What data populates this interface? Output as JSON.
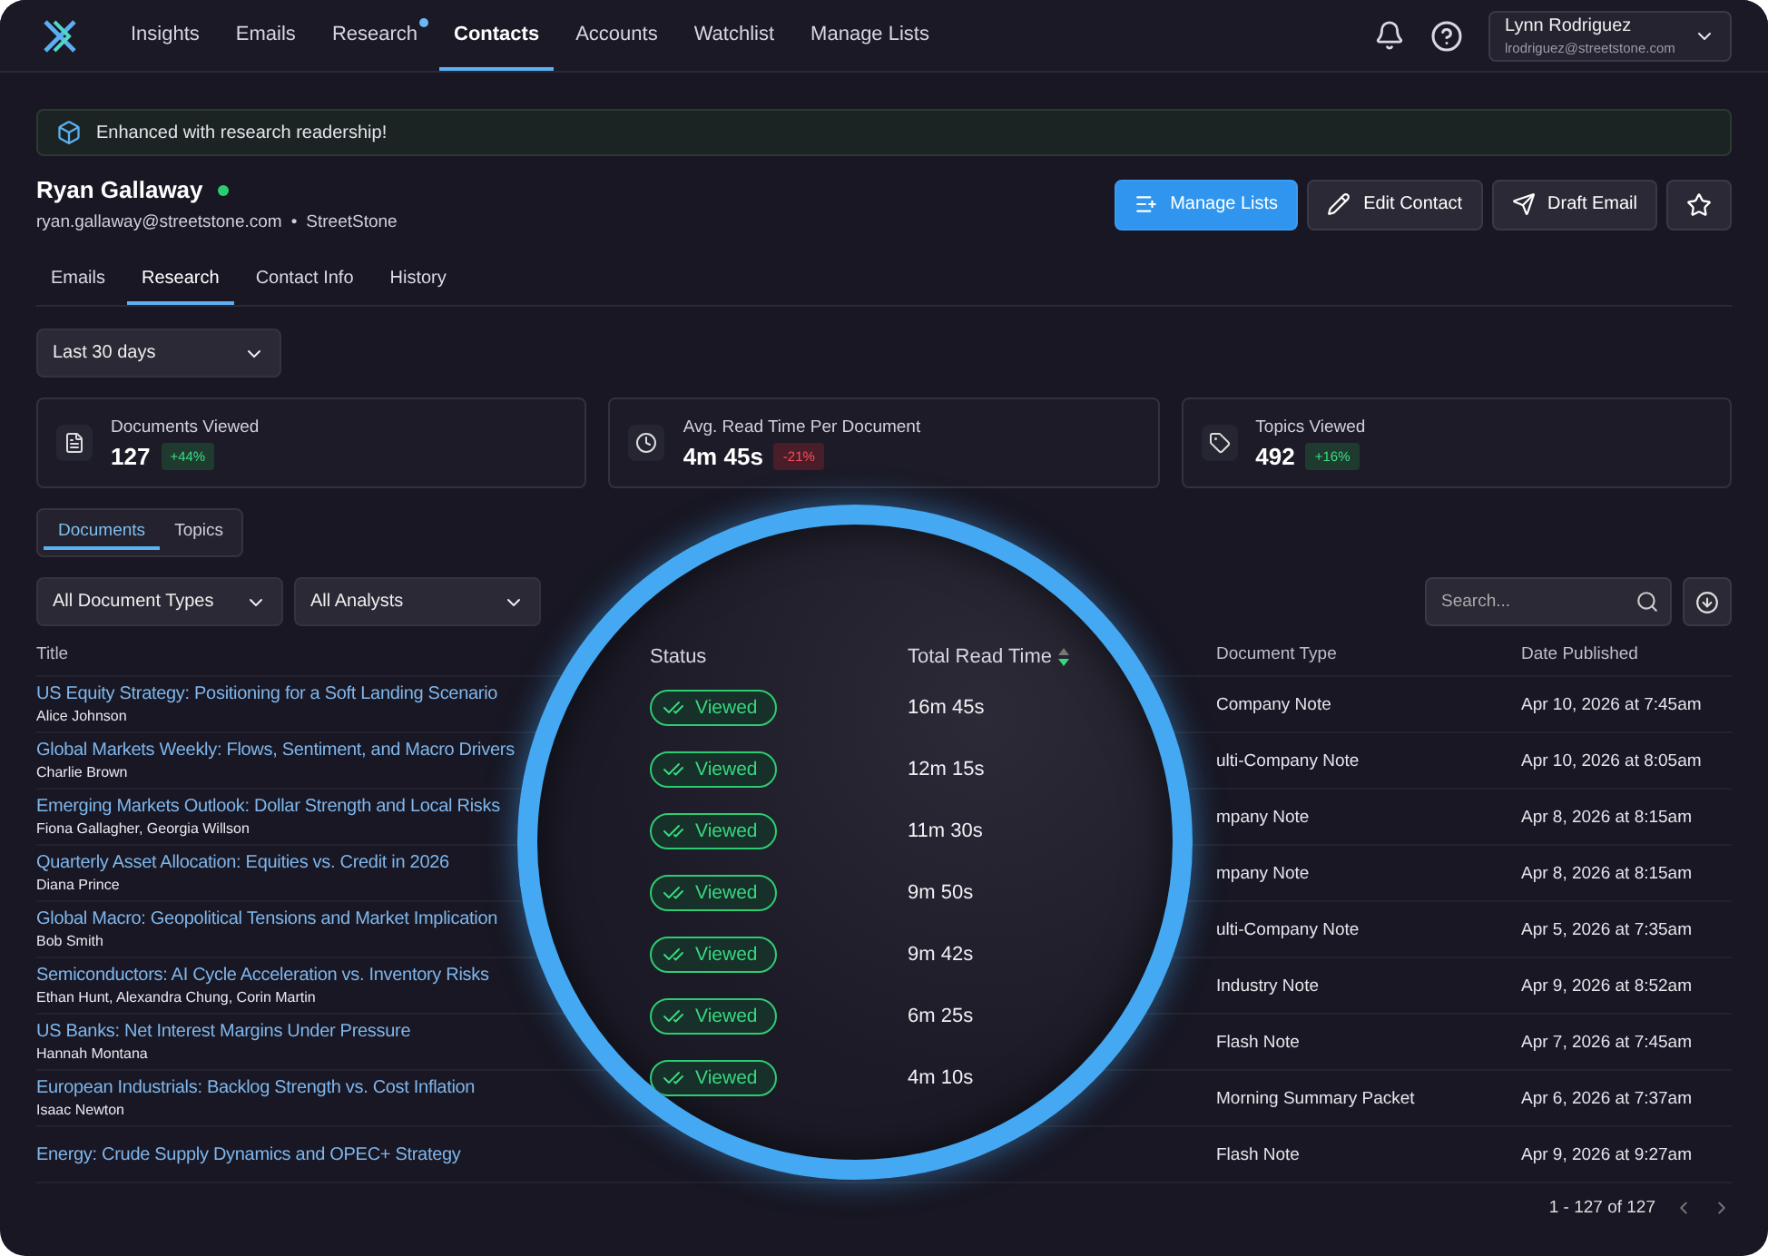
{
  "nav": {
    "items": [
      {
        "label": "Insights",
        "selected": false,
        "dot": false
      },
      {
        "label": "Emails",
        "selected": false,
        "dot": false
      },
      {
        "label": "Research",
        "selected": false,
        "dot": true
      },
      {
        "label": "Contacts",
        "selected": true,
        "dot": false
      },
      {
        "label": "Accounts",
        "selected": false,
        "dot": false
      },
      {
        "label": "Watchlist",
        "selected": false,
        "dot": false
      },
      {
        "label": "Manage Lists",
        "selected": false,
        "dot": false
      }
    ],
    "user": {
      "name": "Lynn Rodriguez",
      "email": "lrodriguez@streetstone.com"
    }
  },
  "banner": {
    "text": "Enhanced with research readership!"
  },
  "contact": {
    "name": "Ryan Gallaway",
    "online": true,
    "email": "ryan.gallaway@streetstone.com",
    "separator": "•",
    "company": "StreetStone"
  },
  "actions": [
    {
      "label": "Manage Lists",
      "kind": "primary"
    },
    {
      "label": "Edit Contact",
      "kind": "edit"
    },
    {
      "label": "Draft Email",
      "kind": "send"
    }
  ],
  "tabs": [
    {
      "label": "Emails",
      "selected": false
    },
    {
      "label": "Research",
      "selected": true
    },
    {
      "label": "Contact Info",
      "selected": false
    },
    {
      "label": "History",
      "selected": false
    }
  ],
  "period": {
    "value": "Last 30 days"
  },
  "stats": [
    {
      "kind": "document",
      "label": "Documents Viewed",
      "value": "127",
      "change": "+44%",
      "rising": true
    },
    {
      "kind": "clock",
      "label": "Avg. Read Time Per Document",
      "value": "4m 45s",
      "change": "-21%",
      "rising": false
    },
    {
      "kind": "tag",
      "label": "Topics Viewed",
      "value": "492",
      "change": "+16%",
      "rising": true
    }
  ],
  "doc_tabs": [
    {
      "label": "Documents",
      "selected": true
    },
    {
      "label": "Topics",
      "selected": false
    }
  ],
  "filters": [
    "All Document Types",
    "All Analysts"
  ],
  "search": {
    "placeholder": "Search..."
  },
  "table": {
    "columns": [
      "Title",
      "Document Type",
      "Date Published"
    ],
    "rows": [
      {
        "title": "US Equity Strategy: Positioning for a Soft Landing Scenario",
        "authors": "Alice Johnson",
        "doc_type": "Company Note",
        "date": "Apr 10, 2026 at 7:45am"
      },
      {
        "title": "Global Markets Weekly: Flows, Sentiment, and Macro Drivers",
        "authors": "Charlie Brown",
        "doc_type": "ulti-Company Note",
        "date": "Apr 10, 2026 at 8:05am"
      },
      {
        "title": "Emerging Markets Outlook: Dollar Strength and Local Risks",
        "authors": "Fiona Gallagher, Georgia Willson",
        "doc_type": "mpany Note",
        "date": "Apr 8, 2026 at 8:15am"
      },
      {
        "title": "Quarterly Asset Allocation: Equities vs. Credit in 2026",
        "authors": "Diana Prince",
        "doc_type": "mpany Note",
        "date": "Apr 8, 2026 at 8:15am"
      },
      {
        "title": "Global Macro: Geopolitical Tensions and Market Implication",
        "authors": "Bob Smith",
        "doc_type": "ulti-Company Note",
        "date": "Apr 5, 2026 at 7:35am"
      },
      {
        "title": "Semiconductors: AI Cycle Acceleration vs. Inventory Risks",
        "authors": "Ethan Hunt, Alexandra Chung, Corin Martin",
        "doc_type": "Industry Note",
        "date": "Apr 9, 2026 at 8:52am"
      },
      {
        "title": "US Banks: Net Interest Margins Under Pressure",
        "authors": "Hannah Montana",
        "doc_type": "Flash Note",
        "date": "Apr 7, 2026 at 7:45am"
      },
      {
        "title": "European Industrials: Backlog Strength vs. Cost Inflation",
        "authors": "Isaac Newton",
        "doc_type": "Morning Summary Packet",
        "date": "Apr 6, 2026 at 7:37am"
      },
      {
        "title": "Energy: Crude Supply Dynamics and OPEC+ Strategy",
        "doc_type": "Flash Note",
        "date": "Apr 9, 2026 at 9:27am"
      }
    ],
    "pagination": "1 - 127 of 127"
  },
  "lens": {
    "columns": [
      {
        "label": "Status"
      },
      {
        "label": "Total Read Time",
        "sort_descending": true
      }
    ],
    "rows": [
      {
        "status": "Viewed",
        "time": "16m 45s"
      },
      {
        "status": "Viewed",
        "time": "12m 15s"
      },
      {
        "status": "Viewed",
        "time": "11m 30s"
      },
      {
        "status": "Viewed",
        "time": "9m 50s"
      },
      {
        "status": "Viewed",
        "time": "9m 42s"
      },
      {
        "status": "Viewed",
        "time": "6m 25s"
      },
      {
        "status": "Viewed",
        "time": "4m 10s"
      }
    ]
  }
}
